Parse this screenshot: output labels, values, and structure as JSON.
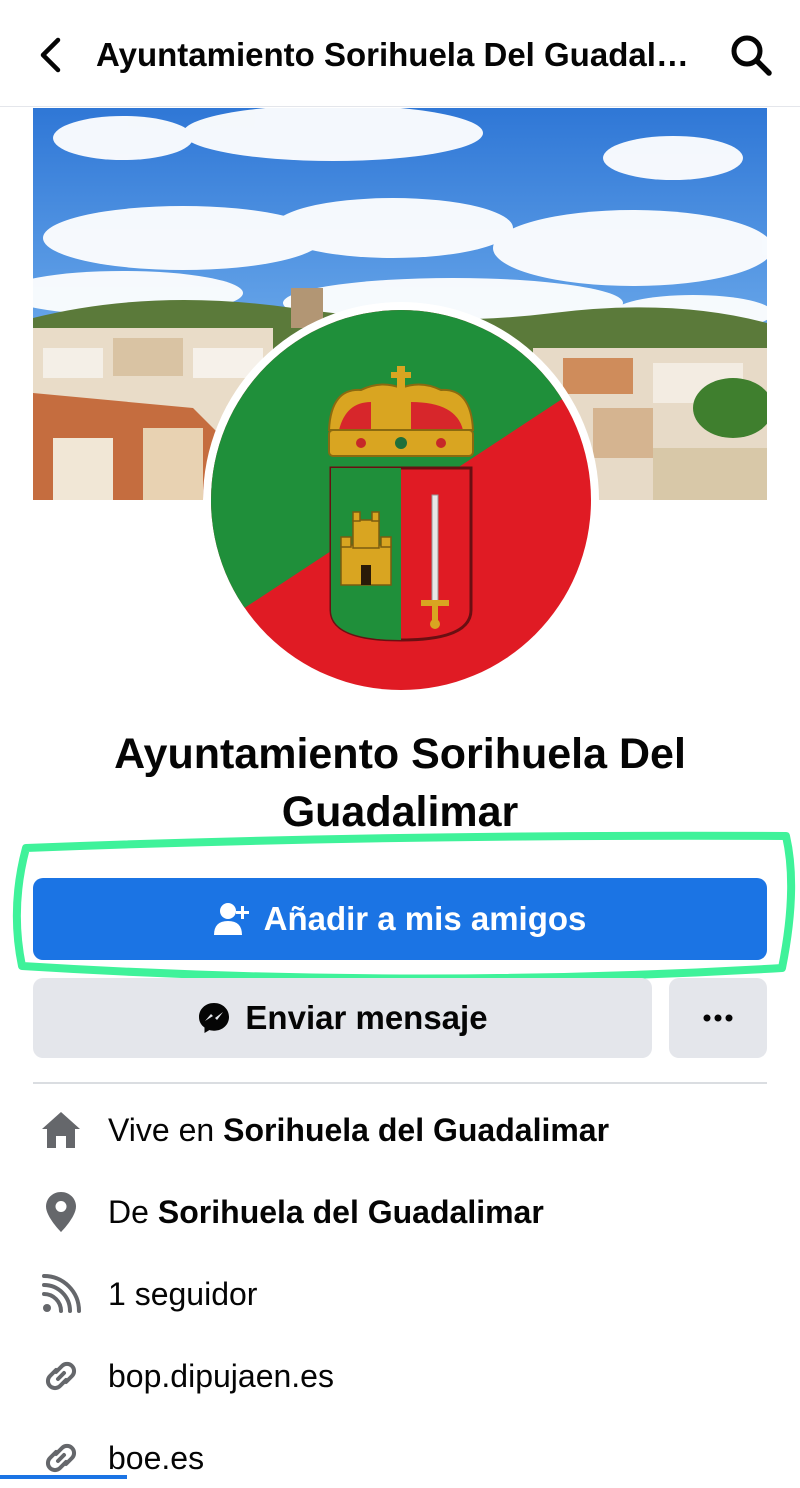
{
  "header": {
    "title": "Ayuntamiento Sorihuela Del Guadal…",
    "back_icon": "back-arrow-icon",
    "search_icon": "search-icon"
  },
  "profile": {
    "name": "Ayuntamiento Sorihuela Del Guadalimar"
  },
  "actions": {
    "add_friend_label": "Añadir a mis amigos",
    "message_label": "Enviar mensaje",
    "more_label": "•••"
  },
  "details": [
    {
      "icon": "home-icon",
      "prefix": "Vive en",
      "value": "Sorihuela del Guadalimar"
    },
    {
      "icon": "location-pin-icon",
      "prefix": "De",
      "value": "Sorihuela del Guadalimar"
    },
    {
      "icon": "rss-icon",
      "prefix": "1 seguidor",
      "value": ""
    },
    {
      "icon": "link-icon",
      "prefix": "bop.dipujaen.es",
      "value": ""
    },
    {
      "icon": "link-icon",
      "prefix": "boe.es",
      "value": ""
    }
  ],
  "colors": {
    "primary_blue": "#1b74e4",
    "secondary_gray": "#e4e6eb",
    "highlight_green": "#3ff29a",
    "crest_green": "#1f8f3a",
    "crest_red": "#e01b24"
  }
}
